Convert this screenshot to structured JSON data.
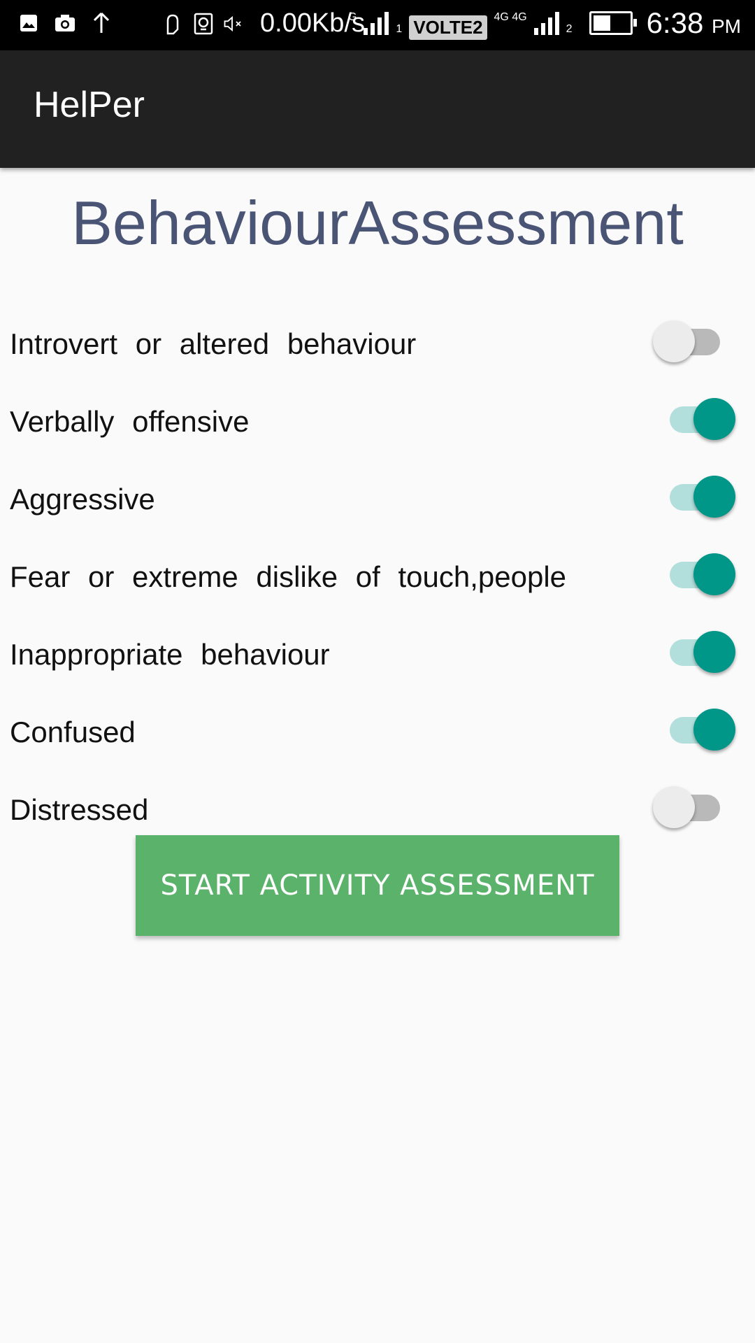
{
  "status_bar": {
    "net_speed": "0.00Kb/s",
    "sim1_type": "G",
    "sim1_index": "1",
    "volte": "VOLTE2",
    "sim2_type": "4G 4G",
    "sim2_index": "2",
    "time": "6:38",
    "ampm": "PM",
    "icons": [
      "image-icon",
      "camera-icon",
      "upload-icon",
      "hand-icon",
      "alarm-icon",
      "mute-icon",
      "battery-icon"
    ]
  },
  "app_bar": {
    "title": "HelPer"
  },
  "page": {
    "title": "BehaviourAssessment"
  },
  "toggles": [
    {
      "label": "Introvert or altered behaviour",
      "checked": false
    },
    {
      "label": "Verbally offensive",
      "checked": true
    },
    {
      "label": "Aggressive",
      "checked": true
    },
    {
      "label": "Fear or extreme dislike of touch,people",
      "checked": true
    },
    {
      "label": "Inappropriate behaviour",
      "checked": true
    },
    {
      "label": "Confused",
      "checked": true
    },
    {
      "label": "Distressed",
      "checked": false
    }
  ],
  "actions": {
    "start_label": "START ACTIVITY ASSESSMENT"
  },
  "colors": {
    "app_bar": "#212121",
    "title": "#4a5474",
    "accent": "#009688",
    "button": "#5bb26b"
  }
}
